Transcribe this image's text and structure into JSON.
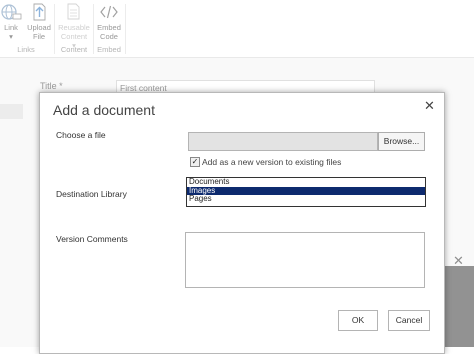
{
  "ribbon": {
    "buttons": [
      {
        "label_line1": "Link",
        "label_line2": "▾",
        "icon": "globe-link-icon"
      },
      {
        "label_line1": "Upload",
        "label_line2": "File",
        "icon": "upload-icon"
      },
      {
        "label_line1": "Reusable",
        "label_line2": "Content ▾",
        "icon": "reusable-content-icon"
      },
      {
        "label_line1": "Embed",
        "label_line2": "Code",
        "icon": "embed-code-icon"
      }
    ],
    "groups": [
      "Links",
      "Content",
      "Embed"
    ]
  },
  "page": {
    "title_label": "Title *",
    "title_value": "First content",
    "close_glyph": "✕"
  },
  "dialog": {
    "title": "Add a document",
    "close_glyph": "✕",
    "choose_file_label": "Choose a file",
    "browse_label": "Browse...",
    "checkbox_checked": true,
    "checkbox_label": "Add as a new version to existing files",
    "destination_label": "Destination Library",
    "library_options": [
      "Documents",
      "Images",
      "Pages"
    ],
    "selected_option": "Images",
    "version_comments_label": "Version Comments",
    "ok_label": "OK",
    "cancel_label": "Cancel"
  },
  "colors": {
    "selection": "#0d2a6e",
    "file_box": "#e3e3e3",
    "dark_strip": "#3a3a3a"
  }
}
